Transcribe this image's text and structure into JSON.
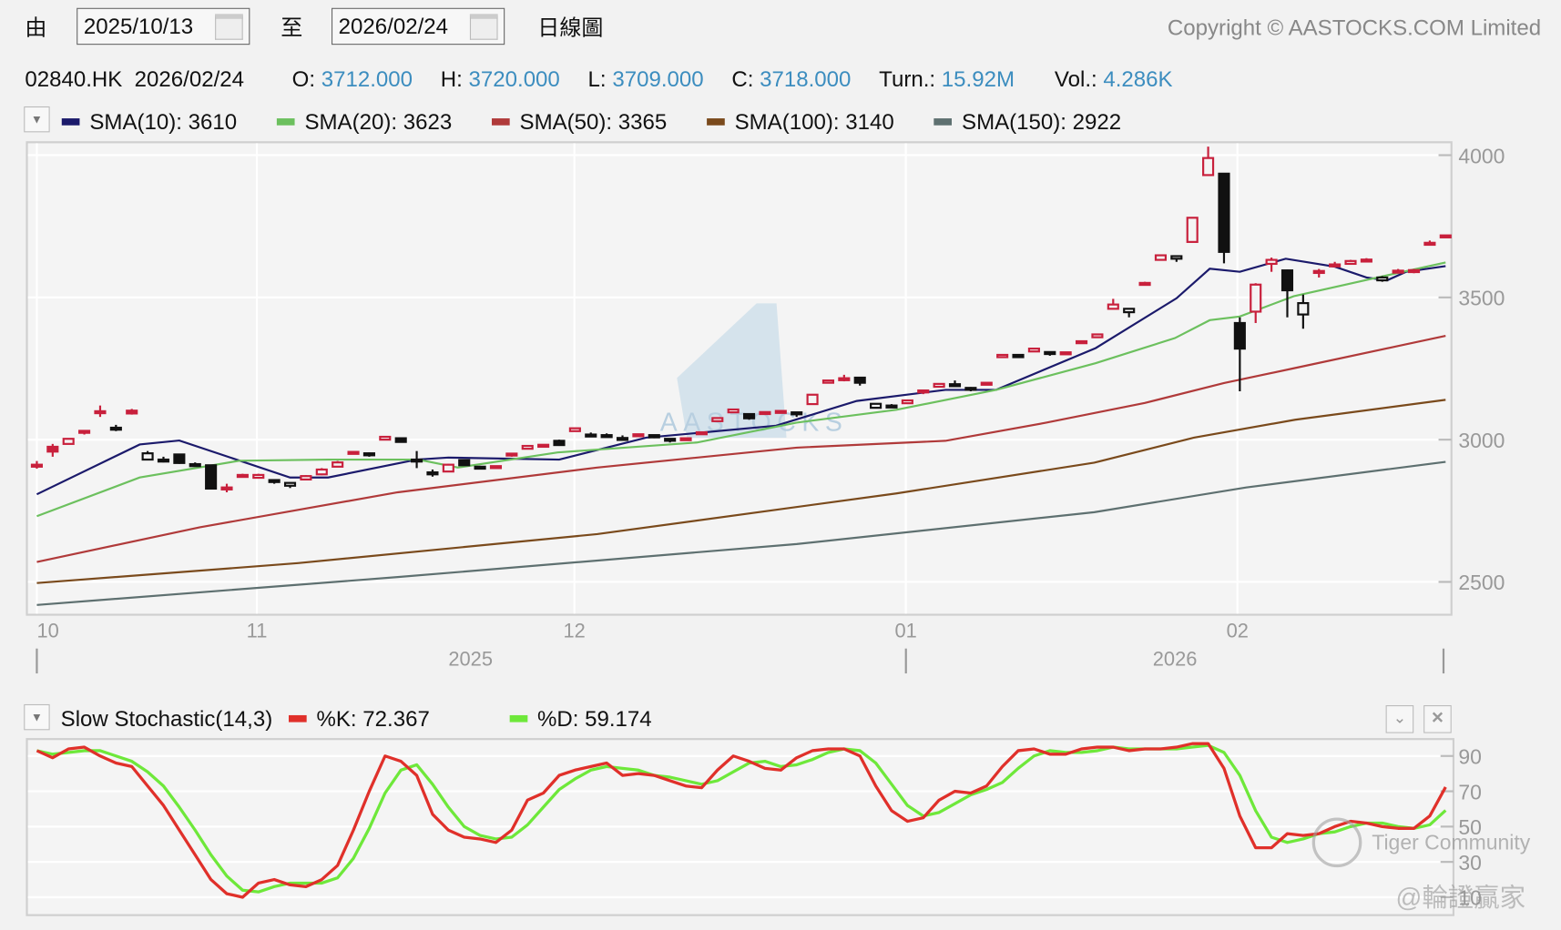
{
  "toolbar": {
    "from_label": "由",
    "from_date": "2025/10/13",
    "to_label": "至",
    "to_date": "2026/02/24",
    "period_label": "日線圖",
    "copyright": "Copyright © AASTOCKS.COM Limited"
  },
  "quote": {
    "symbol_date": "02840.HK  2026/02/24",
    "open_label": "O:",
    "open": "3712.000",
    "high_label": "H:",
    "high": "3720.000",
    "low_label": "L:",
    "low": "3709.000",
    "close_label": "C:",
    "close": "3718.000",
    "turnover_label": "Turn.:",
    "turnover": "15.92M",
    "volume_label": "Vol.:",
    "volume": "4.286K"
  },
  "legend": [
    {
      "label": "SMA(10): 3610",
      "color": "#1b1a6b"
    },
    {
      "label": "SMA(20): 3623",
      "color": "#6cc05e"
    },
    {
      "label": "SMA(50): 3365",
      "color": "#b03a3a"
    },
    {
      "label": "SMA(100): 3140",
      "color": "#7a4a1c"
    },
    {
      "label": "SMA(150): 2922",
      "color": "#5e7070"
    }
  ],
  "colors": {
    "up": "#c8203c",
    "down": "#111111",
    "k": "#e0302a",
    "d": "#6ee83a"
  },
  "watermarks": {
    "logo": "AASTOCKS",
    "tiger": "Tiger Community",
    "cn": "@輪證贏家"
  },
  "stoch": {
    "title": "Slow Stochastic(14,3)",
    "k_label": "%K: 72.367",
    "d_label": "%D: 59.174"
  },
  "chart_data": [
    {
      "type": "candlestick",
      "title": "02840.HK daily",
      "ylim": [
        2460,
        4050
      ],
      "yticks": [
        "4000",
        "3500",
        "3000",
        "2500"
      ],
      "ytick_values": [
        4000,
        3500,
        3000,
        2500
      ],
      "xticks": [
        {
          "label": "10",
          "index": 0
        },
        {
          "label": "11",
          "index": 13.9
        },
        {
          "label": "12",
          "index": 33.96
        },
        {
          "label": "01",
          "index": 54.9
        },
        {
          "label": "02",
          "index": 75.85
        }
      ],
      "years": [
        {
          "label": "2025",
          "index": 27.4
        },
        {
          "label": "2026",
          "index": 71.9
        }
      ],
      "ohlc": [
        [
          2910,
          2925,
          2898,
          2912
        ],
        [
          2975,
          2985,
          2940,
          2958
        ],
        [
          2985,
          3005,
          2985,
          3003
        ],
        [
          3030,
          3032,
          3018,
          3031
        ],
        [
          3098,
          3120,
          3080,
          3100
        ],
        [
          3042,
          3052,
          3030,
          3038
        ],
        [
          3102,
          3108,
          3088,
          3092
        ],
        [
          2930,
          2960,
          2930,
          2952
        ],
        [
          2930,
          2940,
          2920,
          2930
        ],
        [
          2948,
          2950,
          2915,
          2918
        ],
        [
          2914,
          2920,
          2910,
          2913
        ],
        [
          2910,
          2912,
          2825,
          2828
        ],
        [
          2830,
          2845,
          2815,
          2832
        ],
        [
          2875,
          2880,
          2870,
          2876
        ],
        [
          2866,
          2880,
          2866,
          2876
        ],
        [
          2858,
          2860,
          2845,
          2857
        ],
        [
          2838,
          2850,
          2830,
          2848
        ],
        [
          2860,
          2875,
          2860,
          2872
        ],
        [
          2878,
          2900,
          2875,
          2895
        ],
        [
          2905,
          2925,
          2905,
          2920
        ],
        [
          2955,
          2958,
          2952,
          2957
        ],
        [
          2952,
          2955,
          2940,
          2950
        ],
        [
          3000,
          3012,
          3000,
          3010
        ],
        [
          3005,
          3006,
          2990,
          2992
        ],
        [
          2930,
          2960,
          2900,
          2930
        ],
        [
          2885,
          2895,
          2870,
          2884
        ],
        [
          2888,
          2915,
          2888,
          2912
        ],
        [
          2928,
          2930,
          2908,
          2910
        ],
        [
          2905,
          2908,
          2895,
          2904
        ],
        [
          2906,
          2908,
          2904,
          2907
        ],
        [
          2950,
          2952,
          2940,
          2951
        ],
        [
          2968,
          2980,
          2968,
          2978
        ],
        [
          2980,
          2983,
          2972,
          2982
        ],
        [
          2996,
          3000,
          2978,
          2981
        ],
        [
          3030,
          3042,
          3030,
          3040
        ],
        [
          3018,
          3025,
          3010,
          3017
        ],
        [
          3016,
          3022,
          3010,
          3015
        ],
        [
          3006,
          3015,
          3000,
          3005
        ],
        [
          3012,
          3020,
          3012,
          3019
        ],
        [
          3016,
          3018,
          3005,
          3008
        ],
        [
          3003,
          3005,
          2990,
          3002
        ],
        [
          3004,
          3006,
          3002,
          3005
        ],
        [
          3024,
          3028,
          3022,
          3026
        ],
        [
          3065,
          3078,
          3065,
          3076
        ],
        [
          3096,
          3108,
          3096,
          3106
        ],
        [
          3090,
          3092,
          3070,
          3075
        ],
        [
          3095,
          3098,
          3090,
          3097
        ],
        [
          3100,
          3102,
          3098,
          3101
        ],
        [
          3096,
          3098,
          3080,
          3095
        ],
        [
          3125,
          3160,
          3125,
          3158
        ],
        [
          3200,
          3210,
          3200,
          3208
        ],
        [
          3215,
          3228,
          3205,
          3216
        ],
        [
          3218,
          3220,
          3190,
          3200
        ],
        [
          3112,
          3128,
          3110,
          3126
        ],
        [
          3120,
          3125,
          3112,
          3120
        ],
        [
          3128,
          3140,
          3128,
          3138
        ],
        [
          3172,
          3175,
          3160,
          3173
        ],
        [
          3186,
          3198,
          3186,
          3196
        ],
        [
          3195,
          3208,
          3190,
          3195
        ],
        [
          3182,
          3185,
          3170,
          3180
        ],
        [
          3198,
          3202,
          3196,
          3200
        ],
        [
          3290,
          3300,
          3290,
          3298
        ],
        [
          3298,
          3300,
          3288,
          3290
        ],
        [
          3310,
          3322,
          3310,
          3320
        ],
        [
          3308,
          3310,
          3295,
          3306
        ],
        [
          3306,
          3308,
          3298,
          3307
        ],
        [
          3345,
          3348,
          3342,
          3346
        ],
        [
          3360,
          3372,
          3360,
          3370
        ],
        [
          3460,
          3495,
          3460,
          3475
        ],
        [
          3448,
          3462,
          3430,
          3460
        ],
        [
          3550,
          3555,
          3545,
          3551
        ],
        [
          3632,
          3650,
          3632,
          3648
        ],
        [
          3636,
          3648,
          3625,
          3645
        ],
        [
          3695,
          3780,
          3695,
          3780
        ],
        [
          3930,
          4030,
          3930,
          3990
        ],
        [
          3935,
          3935,
          3620,
          3660
        ],
        [
          3410,
          3430,
          3170,
          3320
        ],
        [
          3450,
          3550,
          3410,
          3545
        ],
        [
          3618,
          3640,
          3590,
          3632
        ],
        [
          3595,
          3598,
          3430,
          3525
        ],
        [
          3440,
          3510,
          3390,
          3480
        ],
        [
          3592,
          3600,
          3570,
          3593
        ],
        [
          3615,
          3625,
          3605,
          3616
        ],
        [
          3618,
          3632,
          3618,
          3628
        ],
        [
          3632,
          3638,
          3628,
          3633
        ],
        [
          3560,
          3575,
          3555,
          3570
        ],
        [
          3592,
          3600,
          3585,
          3594
        ],
        [
          3594,
          3600,
          3585,
          3596
        ],
        [
          3690,
          3700,
          3688,
          3692
        ],
        [
          3712,
          3720,
          3709,
          3718
        ]
      ],
      "sma": [
        {
          "name": "SMA(10)",
          "points": [
            [
              0,
              2808
            ],
            [
              6.5,
              2983
            ],
            [
              9,
              2997
            ],
            [
              16,
              2867
            ],
            [
              18.4,
              2867
            ],
            [
              24,
              2930
            ],
            [
              26,
              2937
            ],
            [
              33,
              2930
            ],
            [
              38.5,
              3007
            ],
            [
              46.7,
              3049
            ],
            [
              51.8,
              3136
            ],
            [
              57.4,
              3175
            ],
            [
              60.6,
              3175
            ],
            [
              66.9,
              3322
            ],
            [
              72,
              3497
            ],
            [
              74.1,
              3601
            ],
            [
              76,
              3590
            ],
            [
              78.9,
              3636
            ],
            [
              82,
              3608
            ],
            [
              84,
              3570
            ],
            [
              85.3,
              3560
            ],
            [
              86.5,
              3590
            ],
            [
              89,
              3610
            ]
          ]
        },
        {
          "name": "SMA(20)",
          "points": [
            [
              0,
              2731
            ],
            [
              6.5,
              2867
            ],
            [
              12.8,
              2926
            ],
            [
              18.4,
              2930
            ],
            [
              24.1,
              2930
            ],
            [
              26.6,
              2902
            ],
            [
              32.9,
              2955
            ],
            [
              41.7,
              2990
            ],
            [
              48,
              3060
            ],
            [
              54.3,
              3105
            ],
            [
              60.6,
              3175
            ],
            [
              66.9,
              3269
            ],
            [
              71.9,
              3357
            ],
            [
              74.1,
              3420
            ],
            [
              76,
              3433
            ],
            [
              79.4,
              3504
            ],
            [
              83.8,
              3559
            ],
            [
              89,
              3623
            ]
          ]
        },
        {
          "name": "SMA(50)",
          "points": [
            [
              0,
              2570
            ],
            [
              10.3,
              2692
            ],
            [
              22.8,
              2815
            ],
            [
              35.4,
              2902
            ],
            [
              48,
              2972
            ],
            [
              57.4,
              2996
            ],
            [
              63.7,
              3059
            ],
            [
              70,
              3129
            ],
            [
              75,
              3199
            ],
            [
              79.5,
              3252
            ],
            [
              89,
              3365
            ]
          ]
        },
        {
          "name": "SMA(100)",
          "points": [
            [
              0,
              2496
            ],
            [
              16.5,
              2566
            ],
            [
              35.4,
              2668
            ],
            [
              54.3,
              2811
            ],
            [
              66.8,
              2919
            ],
            [
              73.1,
              3007
            ],
            [
              79.5,
              3070
            ],
            [
              89,
              3140
            ]
          ]
        },
        {
          "name": "SMA(150)",
          "points": [
            [
              0,
              2419
            ],
            [
              22.8,
              2517
            ],
            [
              48,
              2633
            ],
            [
              66.8,
              2745
            ],
            [
              76.4,
              2832
            ],
            [
              89,
              2922
            ]
          ]
        }
      ]
    },
    {
      "type": "line",
      "title": "Slow Stochastic(14,3)",
      "ylim": [
        0,
        100
      ],
      "yticks": [
        "90",
        "70",
        "50",
        "30",
        "10"
      ],
      "ytick_values": [
        90,
        70,
        50,
        30,
        10
      ],
      "series": [
        {
          "name": "%K",
          "values": [
            93,
            89,
            94,
            95,
            90,
            86,
            84,
            73,
            62,
            48,
            34,
            20,
            12,
            10,
            18,
            20,
            17,
            16,
            20,
            28,
            48,
            70,
            90,
            87,
            79,
            57,
            48,
            44,
            43,
            41,
            48,
            65,
            69,
            79,
            82,
            84,
            86,
            79,
            80,
            79,
            76,
            73,
            72,
            82,
            90,
            87,
            83,
            82,
            89,
            93,
            94,
            94,
            90,
            73,
            59,
            53,
            55,
            65,
            70,
            69,
            73,
            84,
            93,
            94,
            91,
            91,
            94,
            95,
            95,
            93,
            94,
            94,
            95,
            97,
            97,
            83,
            56,
            38,
            38,
            46,
            45,
            46,
            50,
            53,
            52,
            50,
            49,
            49,
            56,
            72.367
          ]
        },
        {
          "name": "%D",
          "values": [
            93,
            91,
            92,
            93,
            93,
            90,
            87,
            81,
            73,
            61,
            48,
            34,
            22,
            14,
            13,
            16,
            18,
            18,
            18,
            21,
            32,
            49,
            69,
            82,
            85,
            74,
            61,
            50,
            45,
            43,
            44,
            51,
            61,
            71,
            77,
            82,
            84,
            83,
            82,
            79,
            78,
            76,
            74,
            76,
            81,
            86,
            87,
            84,
            85,
            88,
            92,
            94,
            93,
            86,
            74,
            62,
            56,
            58,
            63,
            68,
            71,
            75,
            83,
            90,
            93,
            92,
            92,
            93,
            95,
            94,
            94,
            94,
            94,
            95,
            96,
            92,
            79,
            59,
            44,
            41,
            43,
            46,
            47,
            50,
            52,
            52,
            50,
            49,
            51,
            59.174
          ]
        }
      ]
    }
  ]
}
